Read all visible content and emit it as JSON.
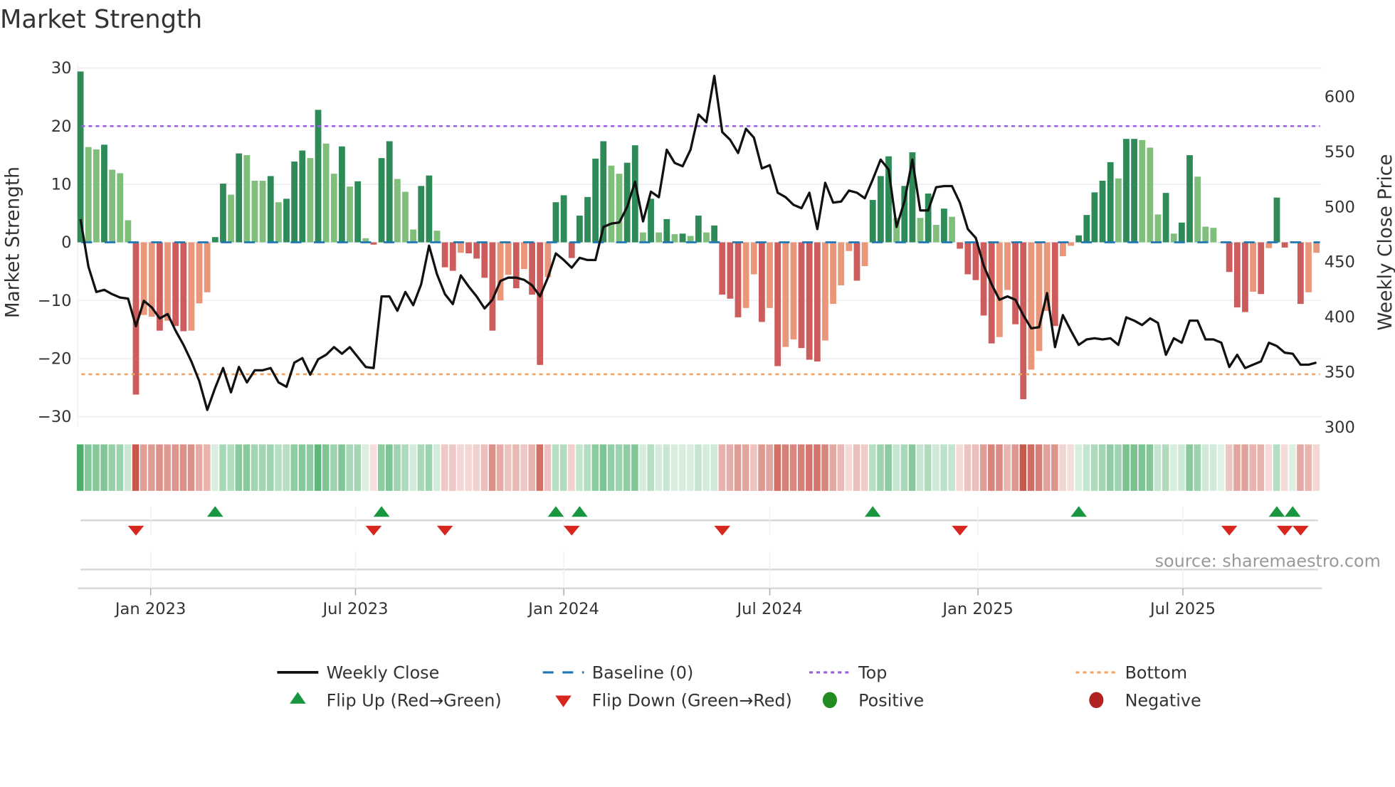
{
  "title": "Market Strength",
  "source_text": "source: sharemaestro.com",
  "chart_data": {
    "type": "bar",
    "title": "Market Strength",
    "x_start": "2022-10-31",
    "x_step_days": 7,
    "x_tick_labels": [
      {
        "date": "2023-01-01",
        "label": "Jan 2023"
      },
      {
        "date": "2023-07-01",
        "label": "Jul 2023"
      },
      {
        "date": "2024-01-01",
        "label": "Jan 2024"
      },
      {
        "date": "2024-07-01",
        "label": "Jul 2024"
      },
      {
        "date": "2025-01-01",
        "label": "Jan 2025"
      },
      {
        "date": "2025-07-01",
        "label": "Jul 2025"
      }
    ],
    "ylabel": "Market Strength",
    "ylim": [
      -32,
      30
    ],
    "yticks": [
      30,
      20,
      10,
      0,
      -10,
      -20,
      -30
    ],
    "ytick_labels": [
      "30",
      "20",
      "10",
      "0",
      "−10",
      "−20",
      "−30"
    ],
    "y2label": "Weekly Close Price",
    "y2lim": [
      300,
      625
    ],
    "y2ticks": [
      600,
      550,
      500,
      450,
      400,
      350,
      300
    ],
    "y2tick_labels": [
      "600",
      "550",
      "500",
      "450",
      "400",
      "350",
      "300"
    ],
    "top_level": 20,
    "bottom_level": -22.7,
    "baseline": 0,
    "strength": [
      29.4,
      16.4,
      16.0,
      16.8,
      12.5,
      11.9,
      3.8,
      -26.2,
      -12.5,
      -12.8,
      -15.2,
      -13.5,
      -14.4,
      -15.3,
      -15.2,
      -10.5,
      -8.6,
      0.9,
      10.1,
      8.2,
      15.3,
      15.0,
      10.6,
      10.6,
      11.4,
      6.9,
      7.5,
      13.9,
      15.8,
      14.5,
      22.8,
      17.0,
      11.8,
      16.5,
      9.6,
      10.5,
      0.7,
      -0.4,
      14.5,
      17.4,
      10.9,
      8.7,
      2.2,
      9.7,
      11.5,
      2.0,
      -4.3,
      -4.9,
      -1.8,
      -1.9,
      -2.8,
      -6.1,
      -15.2,
      -10.0,
      -5.6,
      -7.9,
      -4.6,
      -9.0,
      -21.1,
      -6.0,
      6.9,
      8.1,
      -2.7,
      4.6,
      7.8,
      14.4,
      17.4,
      13.2,
      11.8,
      13.7,
      16.7,
      1.7,
      7.5,
      1.7,
      4.0,
      1.4,
      1.5,
      1.1,
      4.6,
      1.7,
      2.9,
      -9.0,
      -9.7,
      -12.9,
      -11.3,
      -5.5,
      -13.7,
      -11.3,
      -21.3,
      -18.0,
      -16.7,
      -18.2,
      -20.2,
      -20.5,
      -16.9,
      -10.6,
      -7.4,
      -1.5,
      -6.6,
      -4.1,
      7.3,
      11.4,
      14.8,
      4.2,
      9.7,
      15.5,
      4.2,
      8.4,
      3.0,
      5.8,
      4.4,
      -1.1,
      -5.5,
      -6.5,
      -12.6,
      -17.4,
      -16.3,
      -8.2,
      -14.1,
      -27.0,
      -21.9,
      -18.7,
      -11.8,
      -14.4,
      -2.4,
      -0.6,
      1.2,
      4.7,
      8.6,
      10.6,
      13.8,
      11.0,
      17.8,
      17.8,
      17.6,
      16.3,
      4.8,
      8.5,
      1.5,
      3.4,
      15.0,
      11.3,
      2.7,
      2.5,
      0.0,
      -5.1,
      -11.2,
      -12.0,
      -8.5,
      -8.9,
      -1.0,
      7.7,
      -0.9,
      0.1,
      -10.6,
      -8.6,
      -1.8
    ],
    "strength_rising": [
      1,
      0,
      0,
      1,
      0,
      0,
      0,
      1,
      0,
      0,
      1,
      0,
      1,
      1,
      0,
      0,
      0,
      1,
      1,
      0,
      1,
      0,
      0,
      0,
      1,
      0,
      1,
      1,
      1,
      0,
      1,
      0,
      0,
      1,
      0,
      1,
      0,
      1,
      1,
      1,
      0,
      0,
      0,
      1,
      1,
      0,
      1,
      1,
      0,
      1,
      1,
      1,
      1,
      0,
      0,
      1,
      0,
      1,
      1,
      0,
      1,
      1,
      1,
      1,
      1,
      1,
      1,
      0,
      0,
      1,
      1,
      0,
      1,
      0,
      1,
      0,
      1,
      0,
      1,
      0,
      1,
      1,
      1,
      1,
      0,
      0,
      1,
      0,
      1,
      0,
      0,
      1,
      1,
      1,
      0,
      0,
      0,
      0,
      1,
      0,
      1,
      1,
      1,
      0,
      1,
      1,
      0,
      1,
      0,
      1,
      0,
      1,
      1,
      1,
      1,
      1,
      0,
      0,
      1,
      1,
      0,
      0,
      0,
      1,
      0,
      0,
      1,
      1,
      1,
      1,
      1,
      0,
      1,
      1,
      0,
      0,
      0,
      1,
      0,
      1,
      1,
      0,
      0,
      0,
      0,
      1,
      1,
      1,
      0,
      1,
      0,
      1,
      1,
      1,
      1,
      0,
      0
    ],
    "weekly_close": [
      488,
      445,
      422,
      424,
      420,
      417,
      416,
      391,
      414,
      408,
      398,
      402,
      387,
      374,
      359,
      341,
      315,
      335,
      353,
      331,
      354,
      340,
      351,
      351,
      353,
      340,
      336,
      358,
      362,
      347,
      361,
      365,
      372,
      366,
      372,
      363,
      354,
      353,
      418,
      418,
      405,
      422,
      410,
      429,
      464,
      438,
      420,
      411,
      437,
      427,
      418,
      407,
      415,
      432,
      435,
      435,
      433,
      428,
      418,
      435,
      457,
      451,
      444,
      453,
      451,
      451,
      481,
      484,
      485,
      499,
      522,
      486,
      513,
      508,
      551,
      539,
      536,
      551,
      583,
      576,
      618,
      567,
      560,
      548,
      570,
      562,
      534,
      537,
      512,
      508,
      501,
      498,
      512,
      479,
      521,
      503,
      504,
      514,
      512,
      507,
      524,
      542,
      533,
      481,
      504,
      542,
      496,
      496,
      517,
      518,
      518,
      503,
      479,
      471,
      446,
      429,
      415,
      418,
      415,
      401,
      389,
      390,
      421,
      372,
      401,
      387,
      374,
      379,
      380,
      379,
      380,
      374,
      399,
      396,
      392,
      398,
      394,
      365,
      380,
      376,
      396,
      396,
      379,
      379,
      376,
      354,
      365,
      353,
      356,
      359,
      376,
      373,
      367,
      366,
      356,
      356,
      358
    ],
    "flip_up_weeks": [
      17,
      38,
      60,
      63,
      100,
      126,
      151,
      153
    ],
    "flip_down_weeks": [
      7,
      37,
      46,
      62,
      81,
      111,
      145,
      152,
      154
    ],
    "legend": [
      {
        "label": "Weekly Close",
        "symbol": "line",
        "color": "#111111"
      },
      {
        "label": "Baseline (0)",
        "symbol": "dash",
        "color": "#1f77b4"
      },
      {
        "label": "Top",
        "symbol": "dot",
        "color": "#9b5de5"
      },
      {
        "label": "Bottom",
        "symbol": "dot",
        "color": "#f4a261"
      },
      {
        "label": "Flip Up (Red→Green)",
        "symbol": "triangle-up",
        "color": "#1a9641"
      },
      {
        "label": "Flip Down (Green→Red)",
        "symbol": "triangle-down",
        "color": "#d7261e"
      },
      {
        "label": "Positive",
        "symbol": "circle",
        "color": "#228b22"
      },
      {
        "label": "Negative",
        "symbol": "circle",
        "color": "#b22222"
      }
    ],
    "colors": {
      "pos_strong": "#2e8b57",
      "pos_weak": "#7fbf7b",
      "neg_strong": "#cd5c5c",
      "neg_weak": "#e9967a",
      "heat_pos": "#2ca050",
      "heat_neg": "#c0392b",
      "line": "#111111",
      "grid": "#eef0f4"
    }
  }
}
